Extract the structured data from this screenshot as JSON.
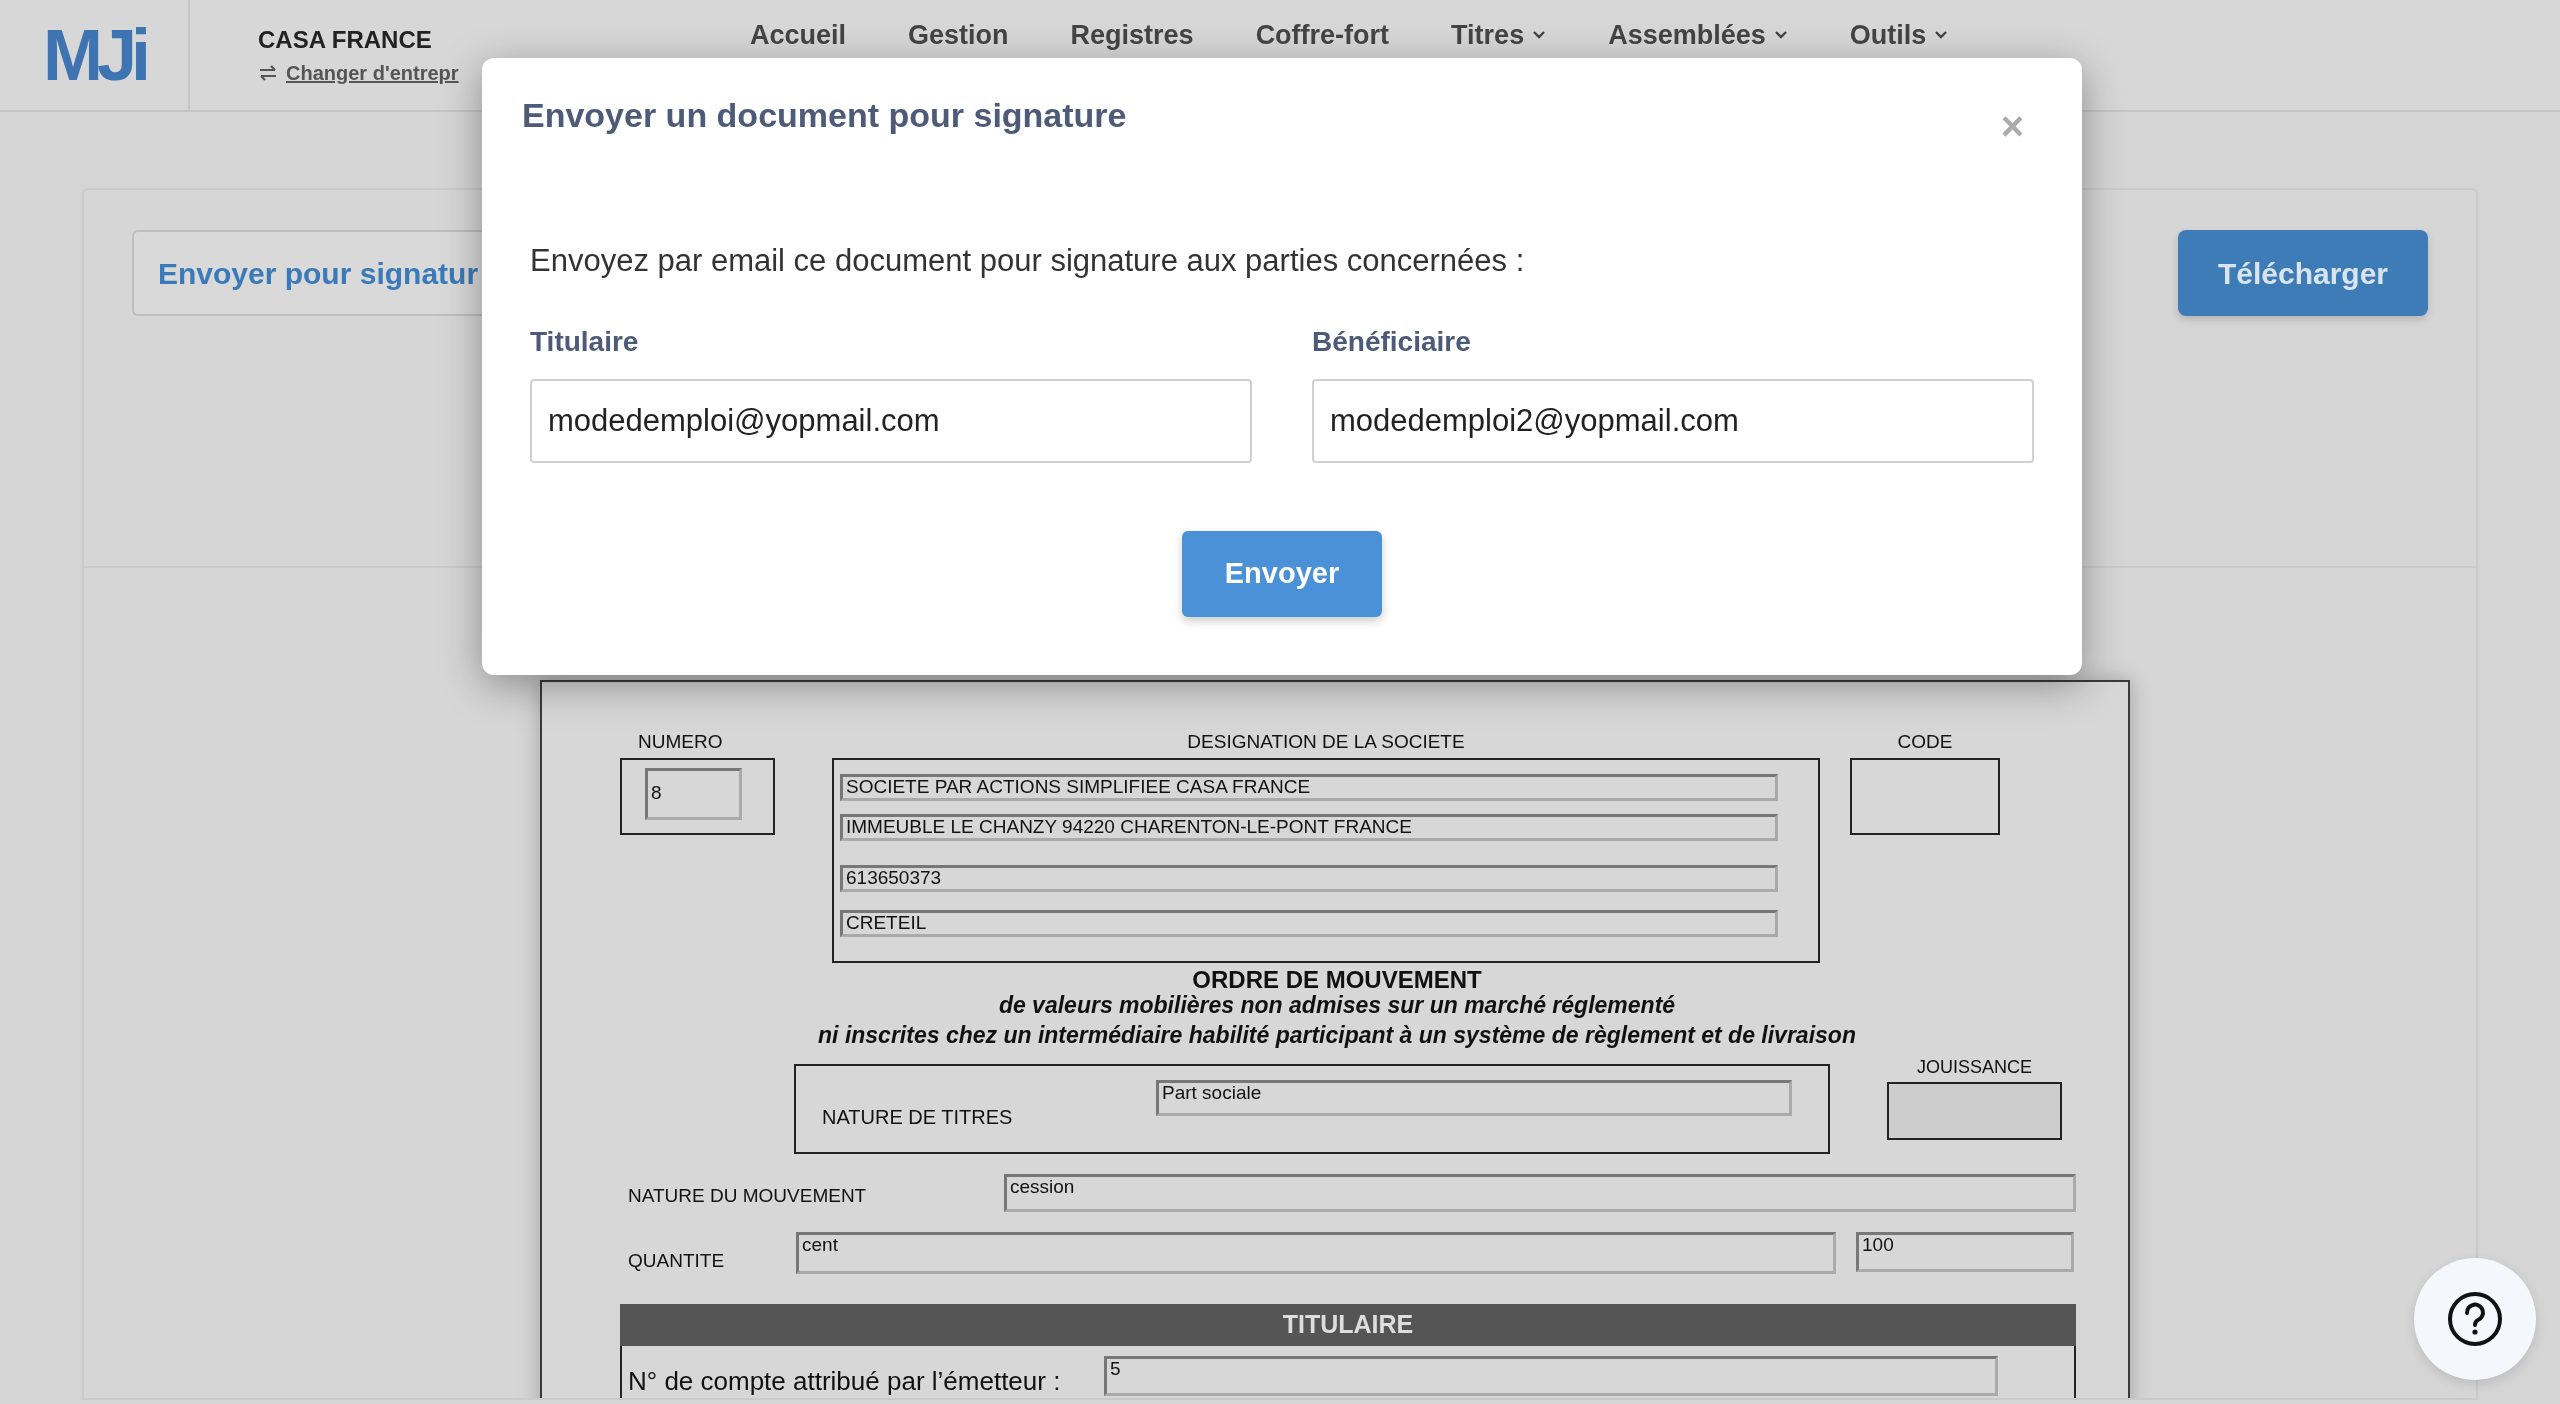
{
  "header": {
    "logo": "MJi",
    "company": "CASA FRANCE",
    "switch_link": "Changer d'entrepr",
    "nav": [
      {
        "label": "Accueil",
        "dropdown": false
      },
      {
        "label": "Gestion",
        "dropdown": false
      },
      {
        "label": "Registres",
        "dropdown": false
      },
      {
        "label": "Coffre-fort",
        "dropdown": false
      },
      {
        "label": "Titres",
        "dropdown": true
      },
      {
        "label": "Assemblées",
        "dropdown": true
      },
      {
        "label": "Outils",
        "dropdown": true
      }
    ]
  },
  "page": {
    "sign_button": "Envoyer pour signatur",
    "download_button": "Télécharger"
  },
  "document": {
    "numero_label": "NUMERO",
    "numero": "8",
    "designation_label": "DESIGNATION DE LA SOCIETE",
    "designation_lines": [
      "SOCIETE PAR ACTIONS SIMPLIFIEE CASA FRANCE",
      "IMMEUBLE LE CHANZY 94220 CHARENTON-LE-PONT FRANCE",
      "613650373",
      "CRETEIL"
    ],
    "code_label": "CODE",
    "title": "ORDRE DE MOUVEMENT",
    "subtitle_lines": [
      "de valeurs mobilières non admises sur un marché réglementé",
      "ni inscrites chez un intermédiaire habilité participant à un système de règlement et de livraison"
    ],
    "nature_titres_label": "NATURE DE TITRES",
    "nature_titres": "Part sociale",
    "jouissance_label": "JOUISSANCE",
    "nature_mouvement_label": "NATURE DU MOUVEMENT",
    "nature_mouvement": "cession",
    "quantite_label": "QUANTITE",
    "quantite_words": "cent",
    "quantite_number": "100",
    "section_title": "TITULAIRE",
    "account_label": "N° de compte attribué par l’émetteur :",
    "account_number": "5"
  },
  "modal": {
    "title": "Envoyer un document pour signature",
    "close": "×",
    "intro": "Envoyez par email ce document pour signature aux parties concernées :",
    "fields": [
      {
        "label": "Titulaire",
        "value": "modedemploi@yopmail.com"
      },
      {
        "label": "Bénéficiaire",
        "value": "modedemploi2@yopmail.com"
      }
    ],
    "submit": "Envoyer"
  }
}
